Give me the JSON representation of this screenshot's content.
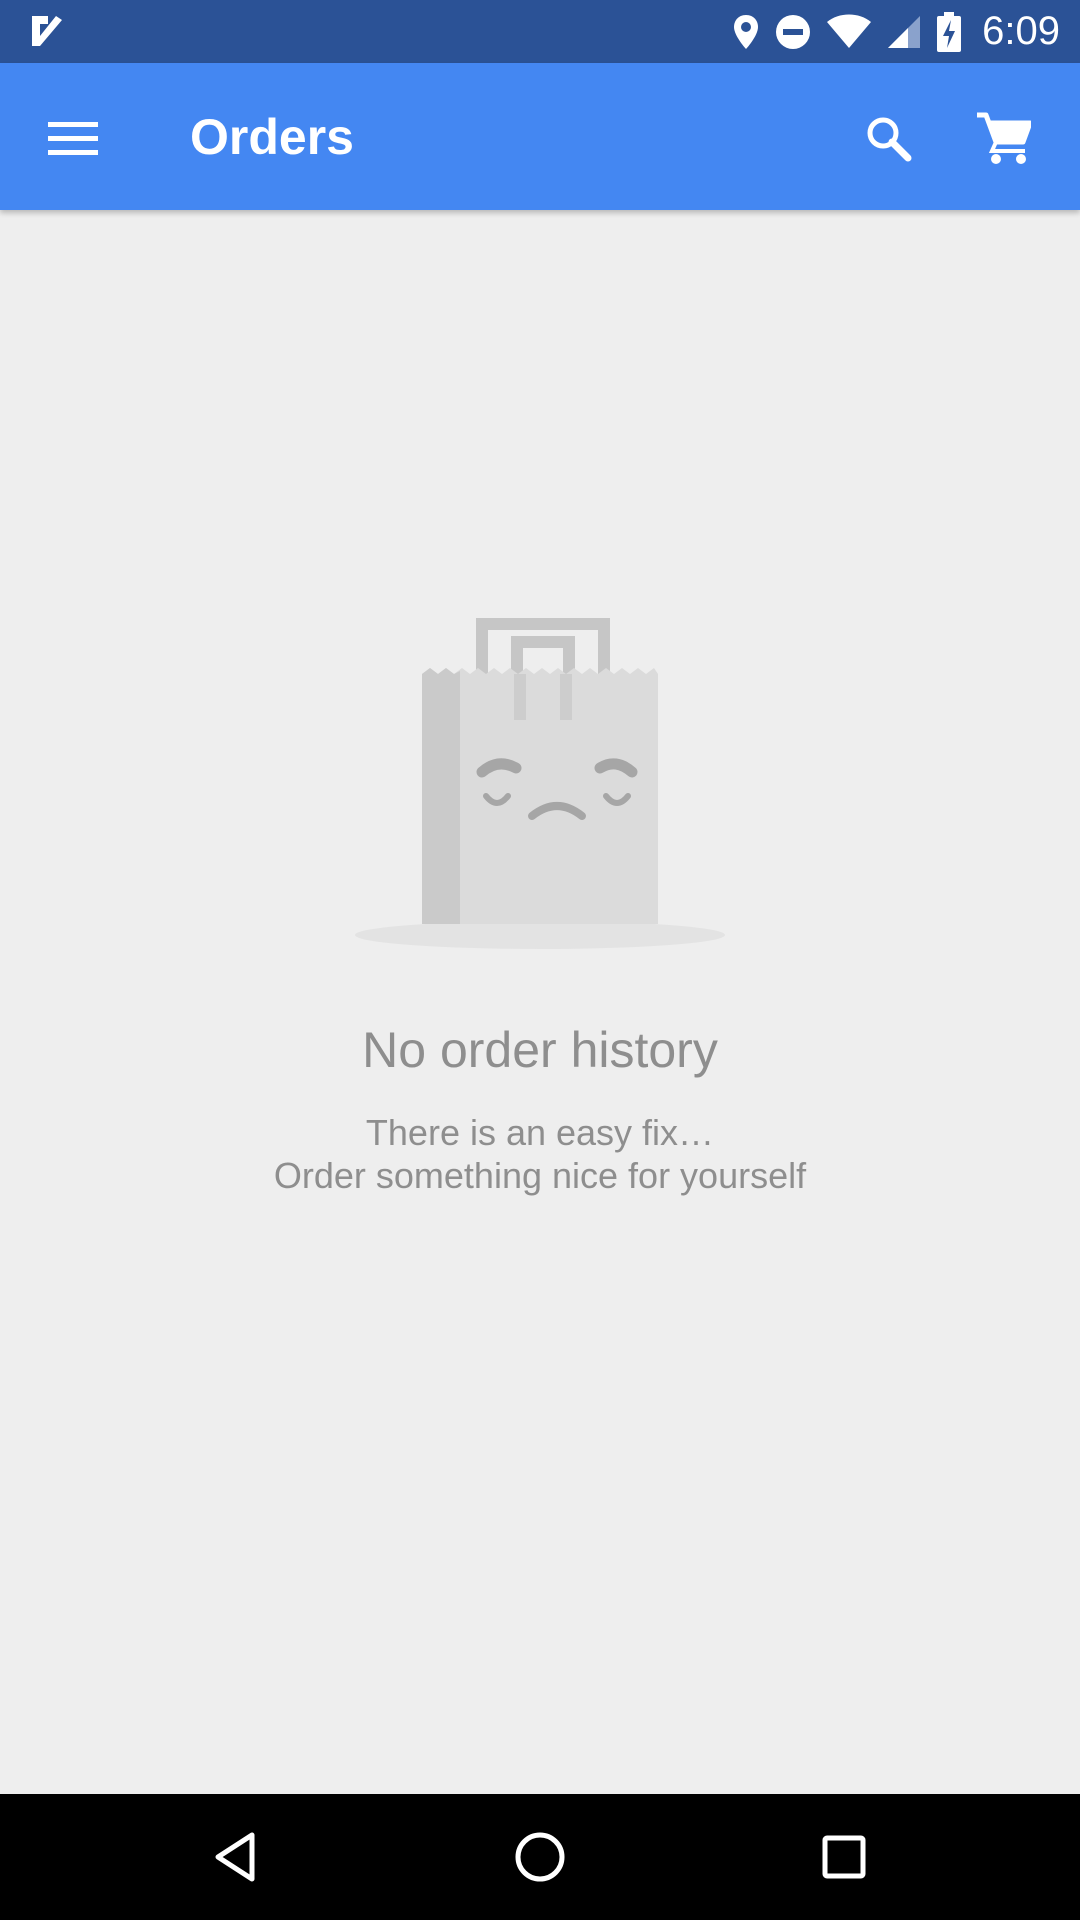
{
  "status_bar": {
    "time": "6:09",
    "icons": [
      "check-notification-icon",
      "location-icon",
      "do-not-disturb-icon",
      "wifi-icon",
      "signal-icon",
      "battery-charging-icon"
    ],
    "background_color": "#2b5296"
  },
  "app_bar": {
    "title": "Orders",
    "background_color": "#4487f2",
    "icons": [
      "menu-icon",
      "search-icon",
      "cart-icon"
    ]
  },
  "empty_state": {
    "title": "No order history",
    "message_line1": "There is an easy fix…",
    "message_line2": "Order something nice for yourself",
    "illustration": "sad-shopping-bag-icon",
    "text_color": "#8e8e8e"
  },
  "nav_bar": {
    "icons": [
      "back-icon",
      "home-icon",
      "recents-icon"
    ]
  }
}
